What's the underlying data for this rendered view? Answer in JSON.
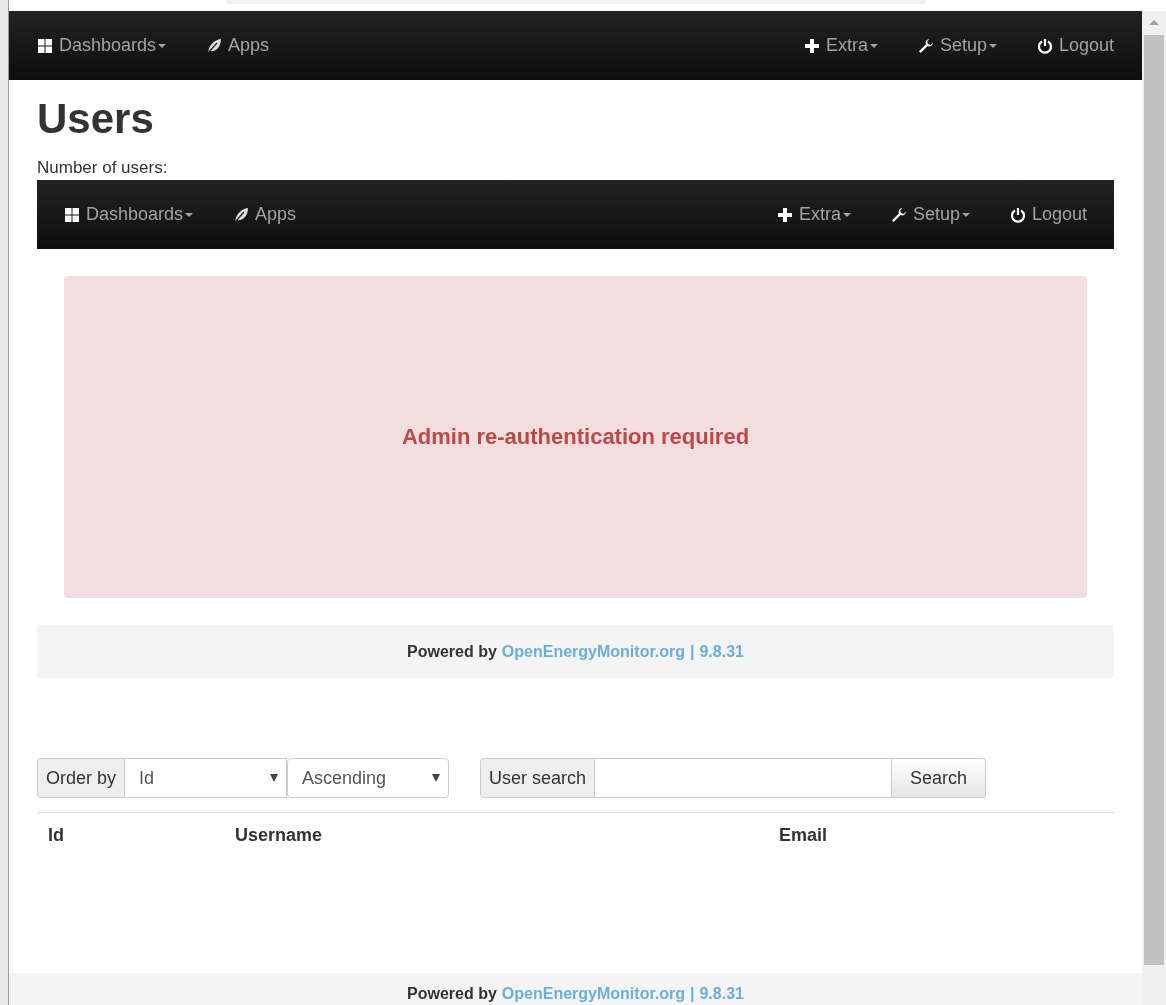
{
  "top_navbar": {
    "left": [
      {
        "kind": "dropdown",
        "label": "Dashboards"
      },
      {
        "kind": "link",
        "label": "Apps"
      }
    ],
    "right": [
      {
        "kind": "dropdown",
        "label": "Extra"
      },
      {
        "kind": "dropdown",
        "label": "Setup"
      },
      {
        "kind": "link",
        "label": "Logout"
      }
    ]
  },
  "page": {
    "title": "Users",
    "subtitle": "Number of users:"
  },
  "embedded": {
    "navbar": {
      "left": [
        {
          "kind": "dropdown",
          "label": "Dashboards"
        },
        {
          "kind": "link",
          "label": "Apps"
        }
      ],
      "right": [
        {
          "kind": "dropdown",
          "label": "Extra"
        },
        {
          "kind": "dropdown",
          "label": "Setup"
        },
        {
          "kind": "link",
          "label": "Logout"
        }
      ]
    },
    "alert": "Admin re-authentication required",
    "footer": {
      "text": "Powered by",
      "link": "OpenEnergyMonitor.org",
      "separator": "|",
      "version": "9.8.31"
    }
  },
  "controls": {
    "order_label": "Order by",
    "order_value": "Id",
    "direction_value": "Ascending",
    "search_label": "User search",
    "search_button": "Search"
  },
  "table": {
    "columns": [
      "Id",
      "Username",
      "Email"
    ]
  },
  "footer": {
    "text": "Powered by",
    "link": "OpenEnergyMonitor.org",
    "separator": "|",
    "version": "9.8.31"
  }
}
